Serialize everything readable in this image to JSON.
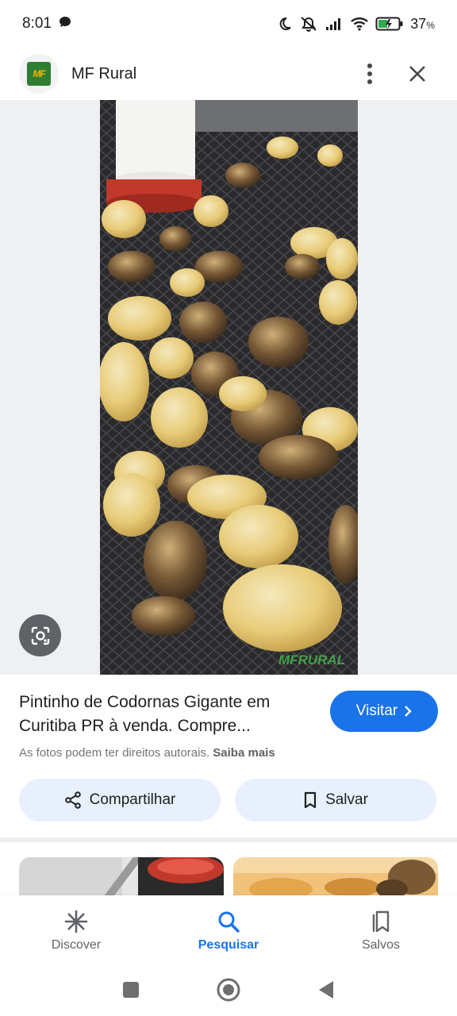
{
  "status_bar": {
    "time": "8:01",
    "battery": "37",
    "battery_unit": "%"
  },
  "header": {
    "logo_text": "MF",
    "site_name": "MF Rural"
  },
  "image": {
    "watermark": "MFRURAL"
  },
  "result": {
    "title": "Pintinho de Codornas Gigante em Curitiba PR à venda. Compre...",
    "visit_label": "Visitar",
    "copyright_text": "As fotos podem ter direitos autorais.",
    "learn_more": "Saiba mais",
    "share_label": "Compartilhar",
    "save_label": "Salvar"
  },
  "bottom_nav": {
    "items": [
      {
        "label": "Discover",
        "icon": "asterisk-icon",
        "active": false
      },
      {
        "label": "Pesquisar",
        "icon": "search-icon",
        "active": true
      },
      {
        "label": "Salvos",
        "icon": "collections-icon",
        "active": false
      }
    ]
  },
  "colors": {
    "accent": "#1a73e8",
    "pill_bg": "#e8f0fe",
    "muted_text": "#70757a"
  }
}
